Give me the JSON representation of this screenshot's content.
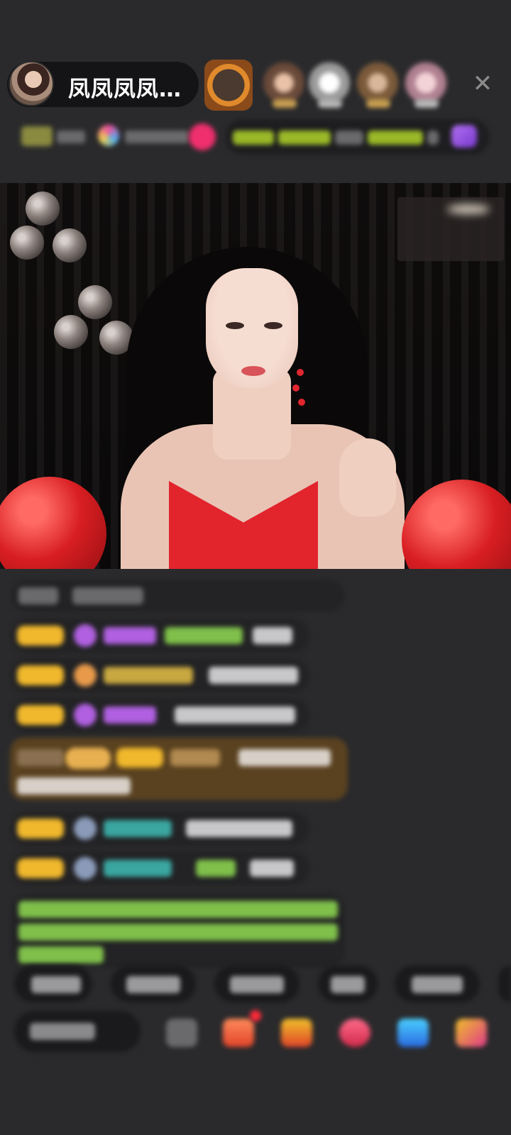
{
  "header": {
    "host_name": "凤凤凤凤…",
    "close_icon": "close-icon"
  },
  "viewers": [
    {
      "name": "viewer-1",
      "color": "#e08a2c"
    },
    {
      "name": "viewer-2",
      "color": "#b88a74"
    },
    {
      "name": "viewer-3",
      "color": "#d9d9d9"
    },
    {
      "name": "viewer-4",
      "color": "#a37d5a"
    },
    {
      "name": "viewer-5",
      "color": "#c7a0b0"
    }
  ],
  "colors": {
    "background": "#2a2a2c",
    "badge_gold": "#f0b82c",
    "chat_green": "#7fbf4a",
    "chat_teal": "#3aa6a0",
    "chat_purple": "#b060e0",
    "dress_red": "#e2242d"
  },
  "quick_actions": {
    "items": [
      "",
      "",
      "",
      "",
      ""
    ]
  },
  "bottom_bar": {
    "say_placeholder": "",
    "tools": [
      "keyboard-icon",
      "gift-box-icon",
      "treasure-icon",
      "red-packet-icon",
      "game-controller-icon",
      "more-apps-icon"
    ]
  }
}
